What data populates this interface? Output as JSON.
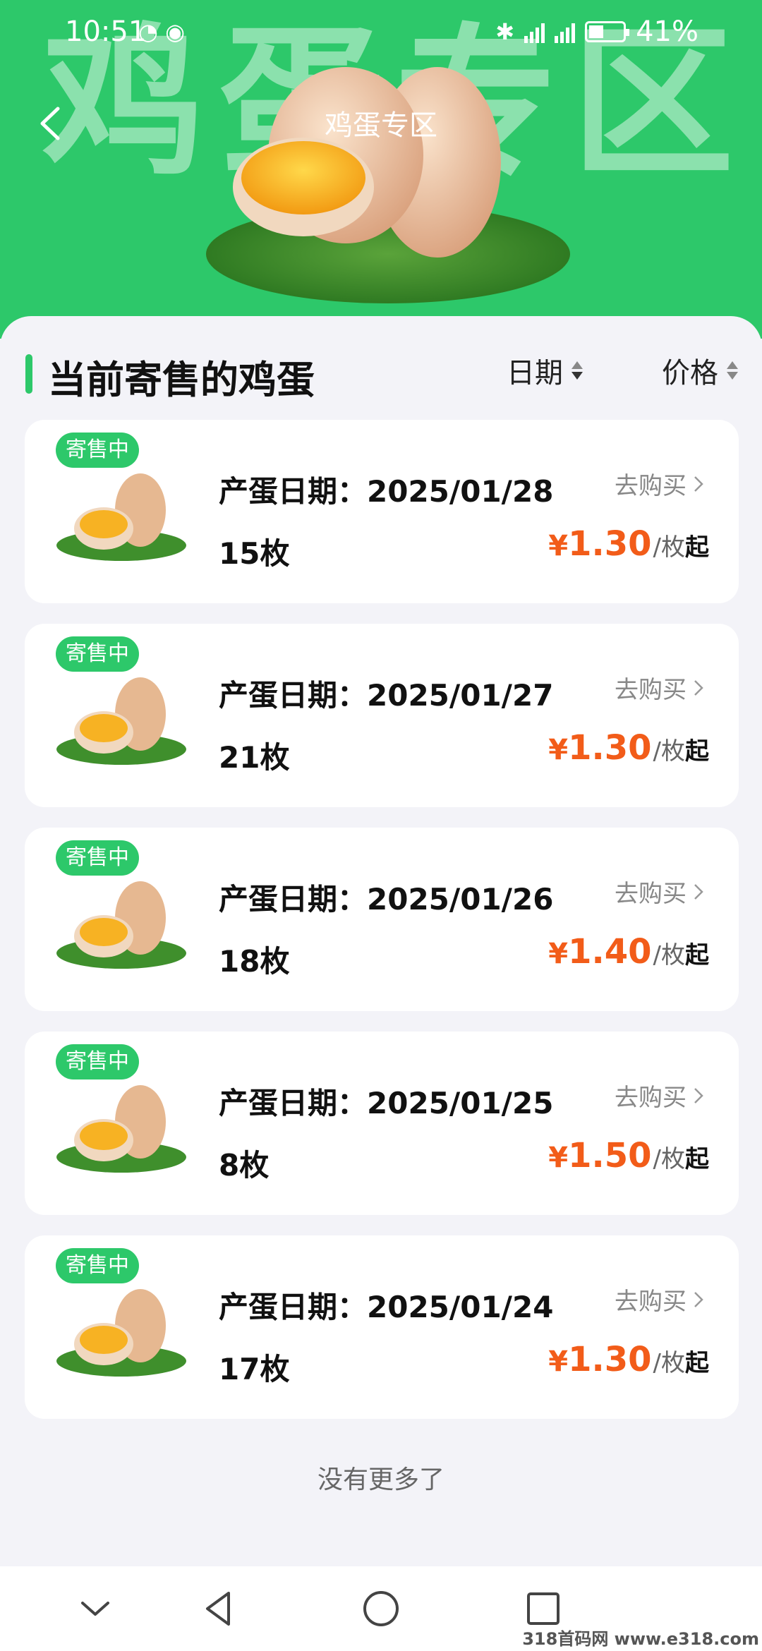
{
  "status_bar": {
    "time": "10:51",
    "battery": "41%"
  },
  "header": {
    "watermark": "鸡蛋专区",
    "title": "鸡蛋专区"
  },
  "section": {
    "title": "当前寄售的鸡蛋",
    "sort_date": "日期",
    "sort_price": "价格"
  },
  "listings": [
    {
      "badge": "寄售中",
      "date": "产蛋日期：2025/01/28",
      "qty": "15枚",
      "buy": "去购买",
      "currency": "¥",
      "price": "1.30",
      "unit": "/枚",
      "suffix": "起"
    },
    {
      "badge": "寄售中",
      "date": "产蛋日期：2025/01/27",
      "qty": "21枚",
      "buy": "去购买",
      "currency": "¥",
      "price": "1.30",
      "unit": "/枚",
      "suffix": "起"
    },
    {
      "badge": "寄售中",
      "date": "产蛋日期：2025/01/26",
      "qty": "18枚",
      "buy": "去购买",
      "currency": "¥",
      "price": "1.40",
      "unit": "/枚",
      "suffix": "起"
    },
    {
      "badge": "寄售中",
      "date": "产蛋日期：2025/01/25",
      "qty": "8枚",
      "buy": "去购买",
      "currency": "¥",
      "price": "1.50",
      "unit": "/枚",
      "suffix": "起"
    },
    {
      "badge": "寄售中",
      "date": "产蛋日期：2025/01/24",
      "qty": "17枚",
      "buy": "去购买",
      "currency": "¥",
      "price": "1.30",
      "unit": "/枚",
      "suffix": "起"
    }
  ],
  "footer_text": "没有更多了",
  "site_watermark": "318首码网 www.e318.com",
  "colors": {
    "brand_green": "#2dc86a",
    "price_orange": "#f25c19"
  }
}
